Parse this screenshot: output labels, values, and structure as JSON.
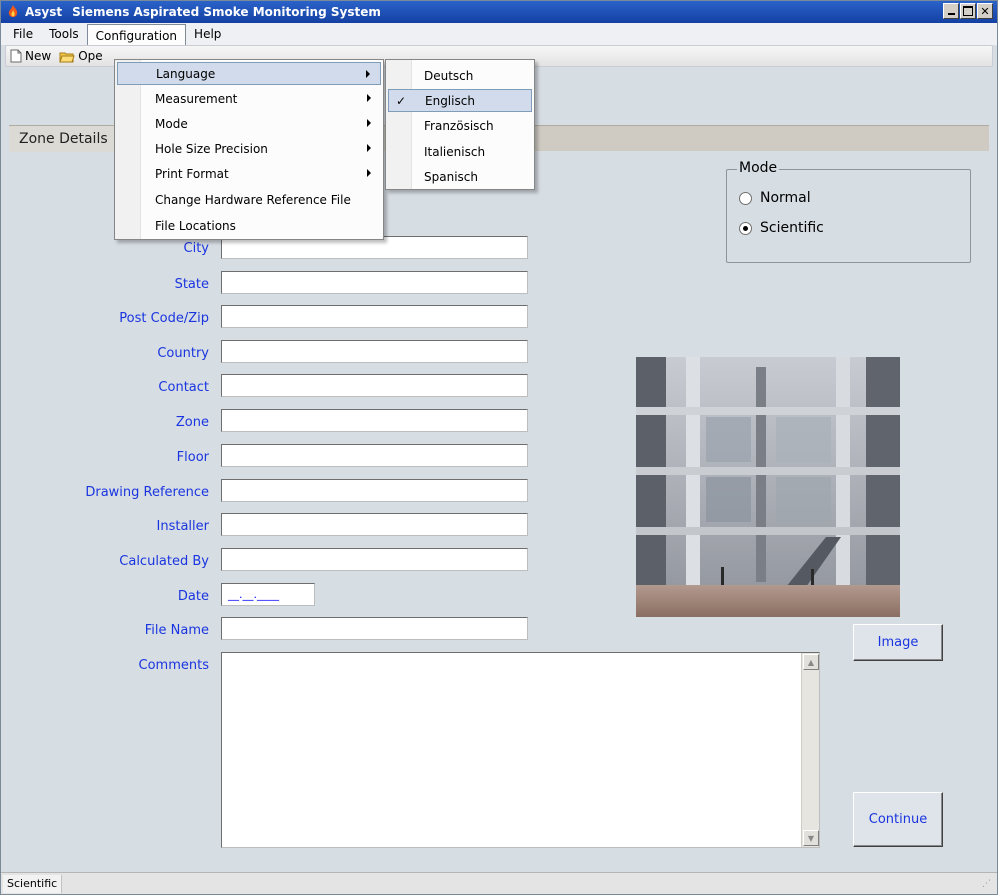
{
  "window": {
    "app_name": "Asyst",
    "title": "Siemens Aspirated Smoke Monitoring System",
    "controls": [
      "minimize",
      "maximize",
      "close"
    ]
  },
  "menubar": {
    "items": [
      "File",
      "Tools",
      "Configuration",
      "Help"
    ]
  },
  "toolbar": {
    "new_label": "New",
    "open_label": "Ope"
  },
  "tab": {
    "label": "Zone Details"
  },
  "form": {
    "fields": [
      {
        "label": "City",
        "value": ""
      },
      {
        "label": "State",
        "value": ""
      },
      {
        "label": "Post Code/Zip",
        "value": ""
      },
      {
        "label": "Country",
        "value": ""
      },
      {
        "label": "Contact",
        "value": ""
      },
      {
        "label": "Zone",
        "value": ""
      },
      {
        "label": "Floor",
        "value": ""
      },
      {
        "label": "Drawing Reference",
        "value": ""
      },
      {
        "label": "Installer",
        "value": ""
      },
      {
        "label": "Calculated By",
        "value": ""
      },
      {
        "label": "Date",
        "value": "__.__.____"
      },
      {
        "label": "File Name",
        "value": ""
      },
      {
        "label": "Comments",
        "value": ""
      }
    ]
  },
  "mode": {
    "title": "Mode",
    "options": [
      "Normal",
      "Scientific"
    ],
    "selected": "Scientific"
  },
  "buttons": {
    "image": "Image",
    "continue": "Continue"
  },
  "statusbar": {
    "text": "Scientific"
  },
  "configuration_menu": {
    "items": [
      {
        "label": "Language",
        "submenu": true,
        "highlighted": true
      },
      {
        "label": "Measurement",
        "submenu": true
      },
      {
        "label": "Mode",
        "submenu": true
      },
      {
        "label": "Hole Size Precision",
        "submenu": true
      },
      {
        "label": "Print Format",
        "submenu": true
      },
      {
        "label": "Change Hardware Reference File",
        "submenu": false
      },
      {
        "label": "File Locations",
        "submenu": false
      }
    ]
  },
  "language_menu": {
    "items": [
      {
        "label": "Deutsch",
        "checked": false
      },
      {
        "label": "Englisch",
        "checked": true
      },
      {
        "label": "Französisch",
        "checked": false
      },
      {
        "label": "Italienisch",
        "checked": false
      },
      {
        "label": "Spanisch",
        "checked": false
      }
    ]
  },
  "colors": {
    "title_bar": "#1f55b8",
    "label_text": "#1a35e0",
    "window_bg": "#d6dde3",
    "menu_highlight": "#d1dbeb"
  }
}
